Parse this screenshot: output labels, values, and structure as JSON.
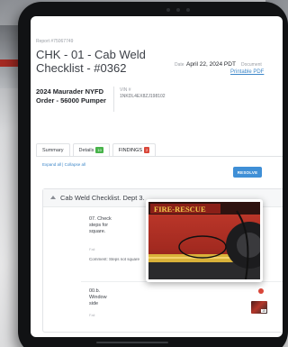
{
  "header": {
    "report_id": "Report #75067749",
    "title": "CHK - 01 - Cab Weld Checklist - #0362",
    "date_label": "Date",
    "date": "April 22, 2024 PDT",
    "document_label": "Document",
    "printable_pdf": "Printable PDF"
  },
  "vehicle": {
    "name": "2024 Maurader NYFD Order - 56000 Pumper",
    "vin_label": "VIN #",
    "vin": "1NKDL4EX8ZJ198102"
  },
  "tabs": [
    {
      "label": "Summary",
      "badge": ""
    },
    {
      "label": "Details",
      "badge": "10"
    },
    {
      "label": "FINDINGS",
      "badge": "2"
    }
  ],
  "expand_collapse": "Expand all | Collapse all",
  "resolve_button": "RESOLVE",
  "checklist": {
    "section_title": "Cab Weld Checklist. Dept 3.",
    "items": [
      {
        "label": "07. Check steps for square.",
        "status": "Fail",
        "comment": "Comment: Steps not square"
      },
      {
        "label": "00.b. Window side",
        "status": "Fail",
        "photo_count": "10"
      }
    ]
  },
  "photo": {
    "text": "FIRE-RESCUE",
    "description_icon": "truck-photo"
  },
  "colors": {
    "accent": "#3f8fd6",
    "fail_red": "#d9473a",
    "badge_green": "#47b34a"
  }
}
